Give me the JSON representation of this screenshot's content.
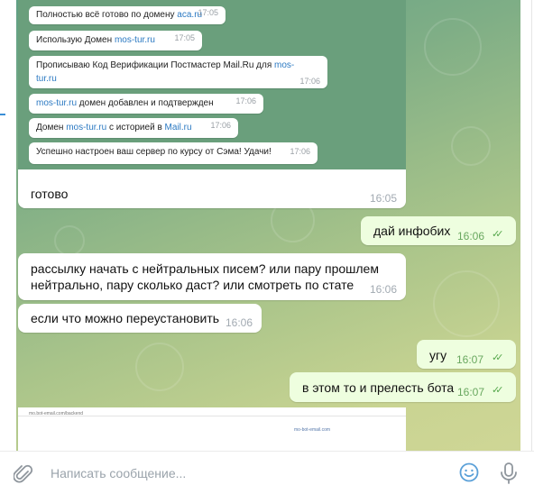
{
  "quoted_messages": [
    {
      "text": "Полностью всё готово по домену ",
      "link": "aca.ru",
      "time": "17:05"
    },
    {
      "text": "Использую Домен ",
      "link": "mos-tur.ru",
      "time": "17:05"
    },
    {
      "line1": "Прописываю Код Верификации Постмастер Mail.Ru для ",
      "line1_link": "mos-",
      "line2_link": "tur.ru",
      "time": "17:06"
    },
    {
      "link": "mos-tur.ru",
      "text": " домен добавлен и подтвержден",
      "time": "17:06"
    },
    {
      "text": "Домен ",
      "link": "mos-tur.ru",
      "text2": " с историей в ",
      "link2": "Mail.ru",
      "time": "17:06"
    },
    {
      "text": "Успешно настроен ваш сервер по курсу от Сэма! Удачи!",
      "time": "17:06"
    }
  ],
  "messages": [
    {
      "direction": "in",
      "text": "готово",
      "time": "16:05"
    },
    {
      "direction": "out",
      "text": "дай инфобих",
      "time": "16:06"
    },
    {
      "direction": "in",
      "line1": "рассылку начать с нейтральных писем? или пару прошлем",
      "line2": "нейтрально, пару сколько даст? или смотреть по стате",
      "time": "16:06"
    },
    {
      "direction": "in",
      "text": "если что можно переустановить",
      "time": "16:06"
    },
    {
      "direction": "out",
      "text": "угу",
      "time": "16:07"
    },
    {
      "direction": "out",
      "text": "в этом то и прелесть бота",
      "time": "16:07"
    }
  ],
  "preview": {
    "url": "mo.bot-email.com/backend",
    "link": "mo-bot-email.com"
  },
  "composer": {
    "placeholder": "Написать сообщение..."
  },
  "icons": {
    "attach": "paperclip-icon",
    "emoji": "emoji-icon",
    "voice": "microphone-icon",
    "read": "double-check-icon"
  },
  "colors": {
    "outgoing_bubble": "#eefedf",
    "link": "#2b79c2",
    "check": "#57a84d",
    "accent": "#5aa0d8"
  }
}
